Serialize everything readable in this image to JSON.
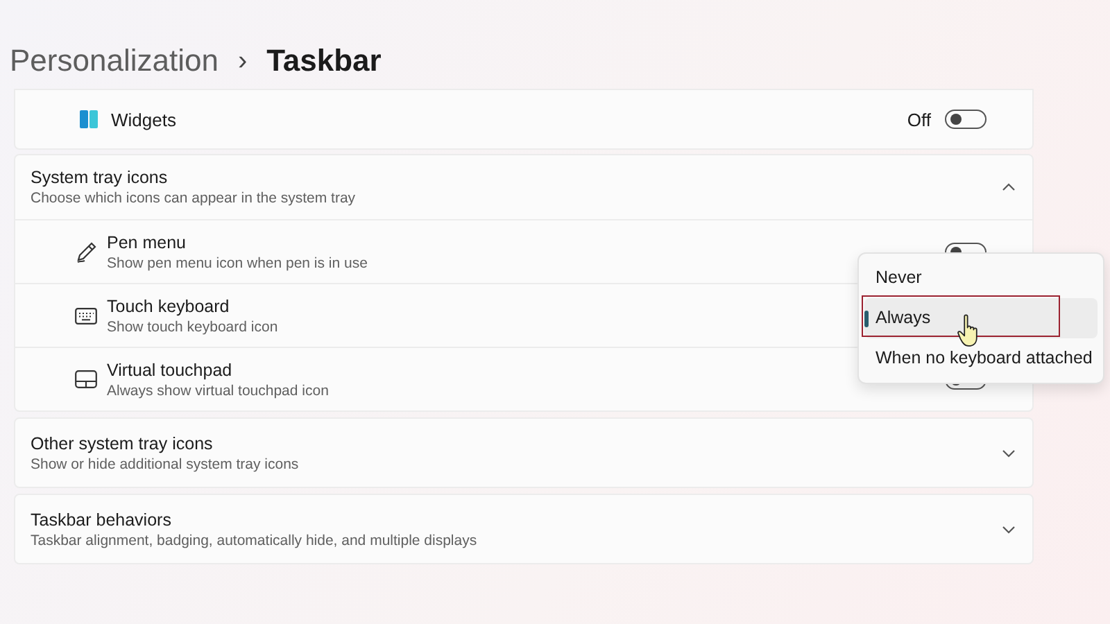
{
  "breadcrumb": {
    "parent": "Personalization",
    "separator": "›",
    "current": "Taskbar"
  },
  "widgets": {
    "label": "Widgets",
    "toggle": {
      "text": "Off",
      "on": false
    }
  },
  "tray": {
    "title": "System tray icons",
    "subtitle": "Choose which icons can appear in the system tray",
    "expanded": true,
    "rows": [
      {
        "kind": "pen",
        "title": "Pen menu",
        "subtitle": "Show pen menu icon when pen is in use",
        "toggle": {
          "on": false
        }
      },
      {
        "kind": "keyboard",
        "title": "Touch keyboard",
        "subtitle": "Show touch keyboard icon"
      },
      {
        "kind": "touchpad",
        "title": "Virtual touchpad",
        "subtitle": "Always show virtual touchpad icon",
        "toggle": {
          "on": false
        }
      }
    ]
  },
  "sections": [
    {
      "title": "Other system tray icons",
      "subtitle": "Show or hide additional system tray icons",
      "expanded": false
    },
    {
      "title": "Taskbar behaviors",
      "subtitle": "Taskbar alignment, badging, automatically hide, and multiple displays",
      "expanded": false
    }
  ],
  "menu": [
    {
      "label": "Never",
      "selected": false
    },
    {
      "label": "Always",
      "selected": true
    },
    {
      "label": "When no keyboard attached",
      "selected": false
    }
  ]
}
